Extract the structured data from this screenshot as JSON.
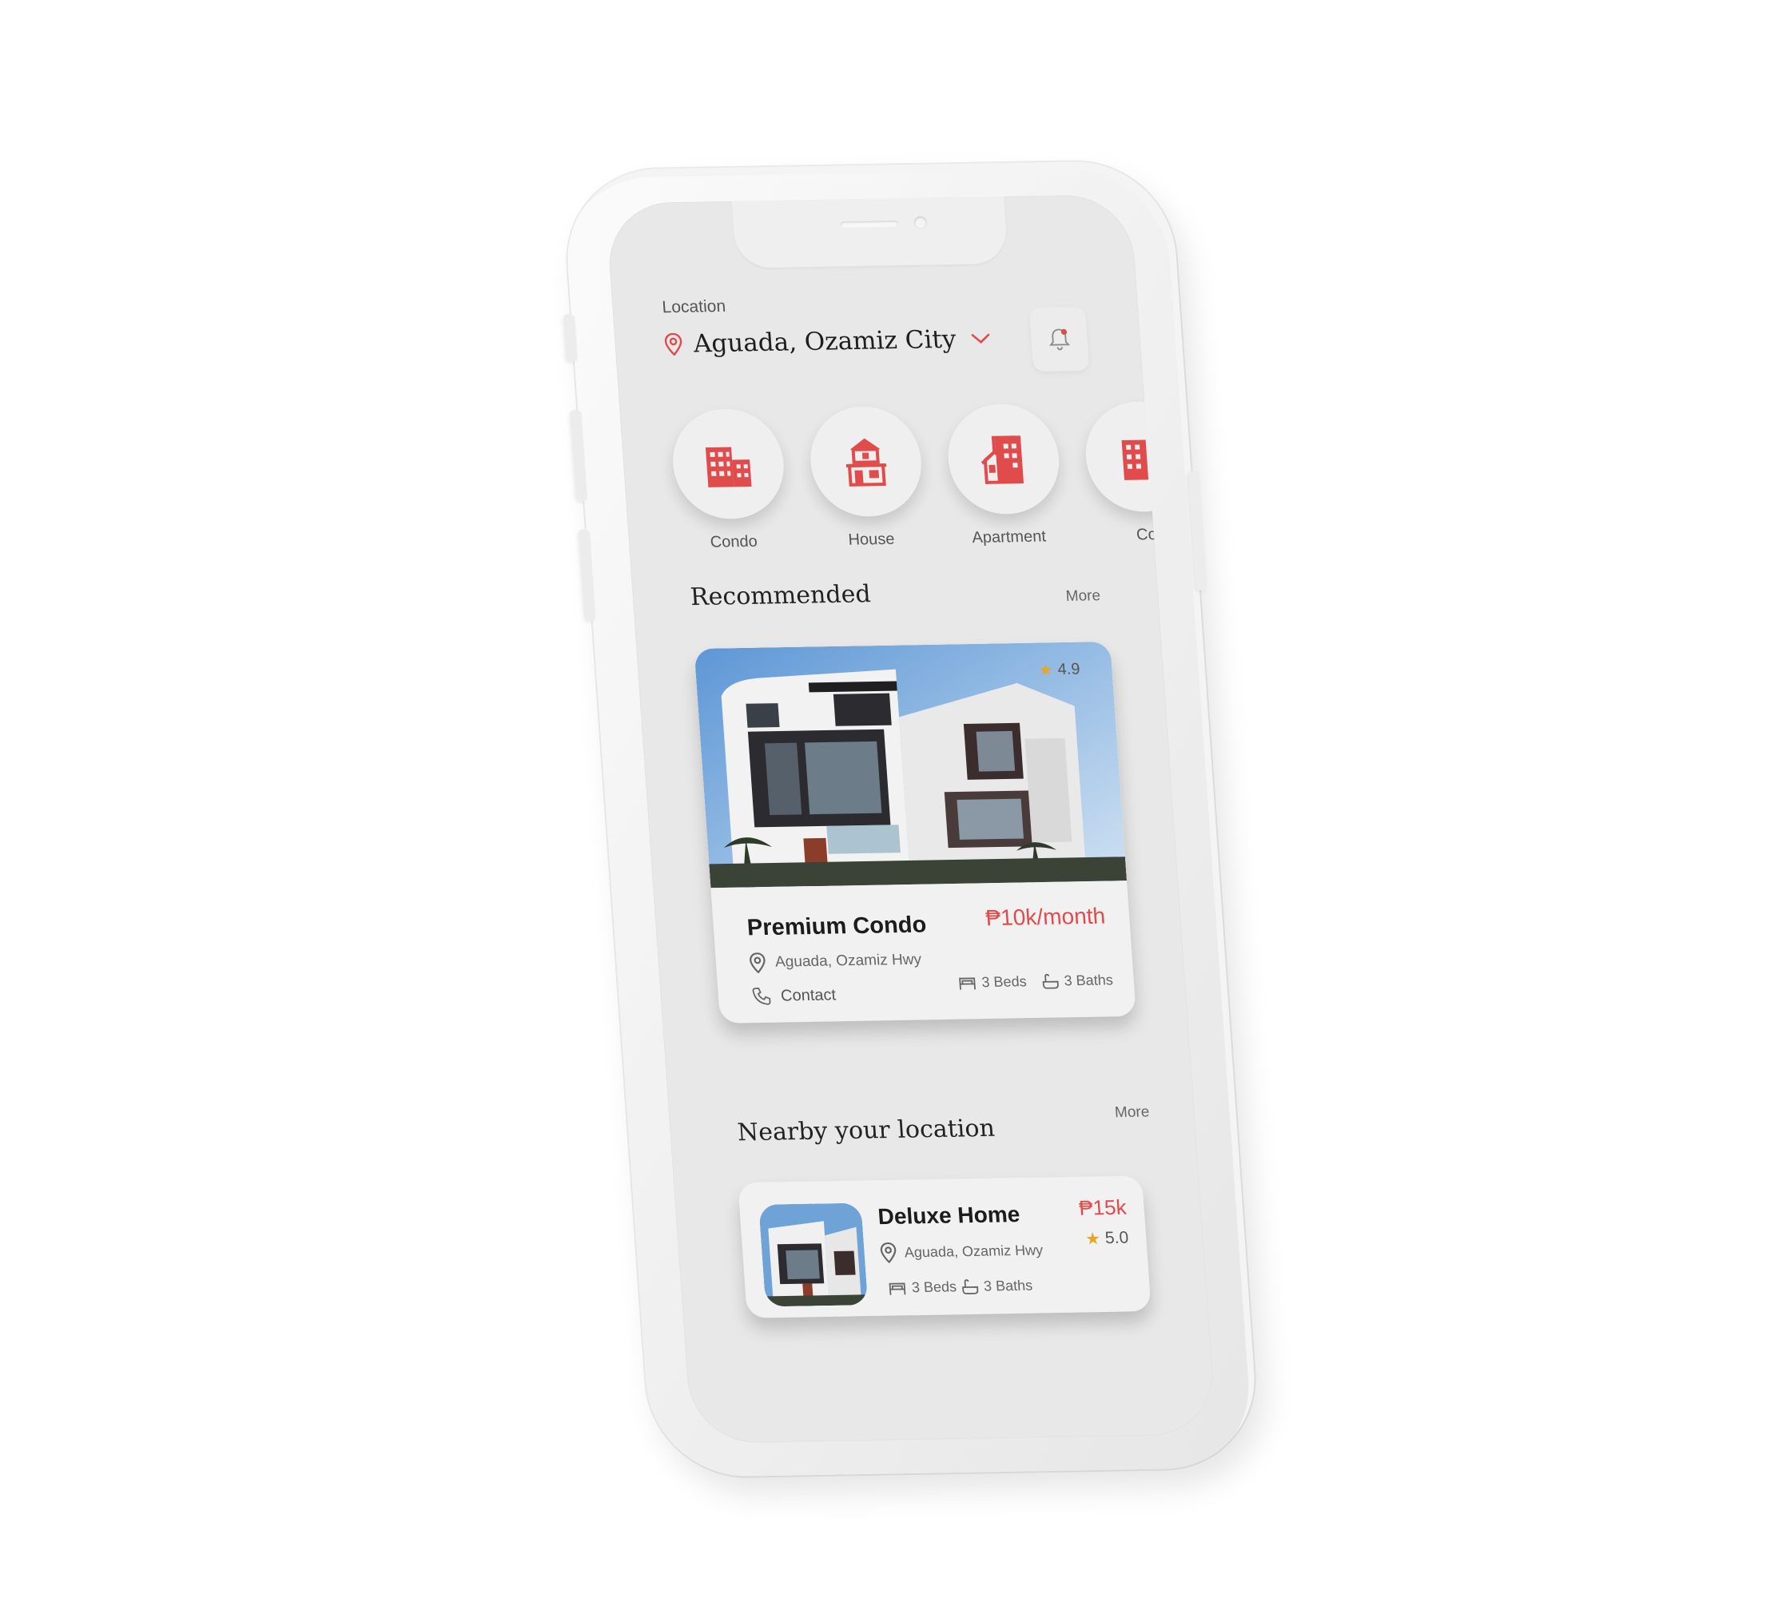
{
  "header": {
    "location_label": "Location",
    "location_value": "Aguada, Ozamiz City"
  },
  "categories": [
    {
      "label": "Condo"
    },
    {
      "label": "House"
    },
    {
      "label": "Apartment"
    },
    {
      "label": "Co"
    }
  ],
  "recommended": {
    "title": "Recommended",
    "more": "More",
    "card": {
      "name": "Premium Condo",
      "price": "₱10k/month",
      "rating": "4.9",
      "address": "Aguada, Ozamiz Hwy",
      "contact": "Contact",
      "beds": "3 Beds",
      "baths": "3 Baths"
    }
  },
  "nearby": {
    "title": "Nearby your location",
    "more": "More",
    "card": {
      "name": "Deluxe Home",
      "price": "₱15k",
      "rating": "5.0",
      "address": "Aguada, Ozamiz Hwy",
      "beds": "3 Beds",
      "baths": "3 Baths"
    }
  },
  "colors": {
    "accent": "#e04b4b",
    "star": "#e5a823",
    "screen_bg": "#e8e8e8"
  },
  "icons": [
    "location-pin-icon",
    "chevron-down-icon",
    "bell-icon",
    "condo-building-icon",
    "house-icon",
    "apartment-icon",
    "star-icon",
    "phone-icon",
    "bed-icon",
    "bath-icon"
  ]
}
